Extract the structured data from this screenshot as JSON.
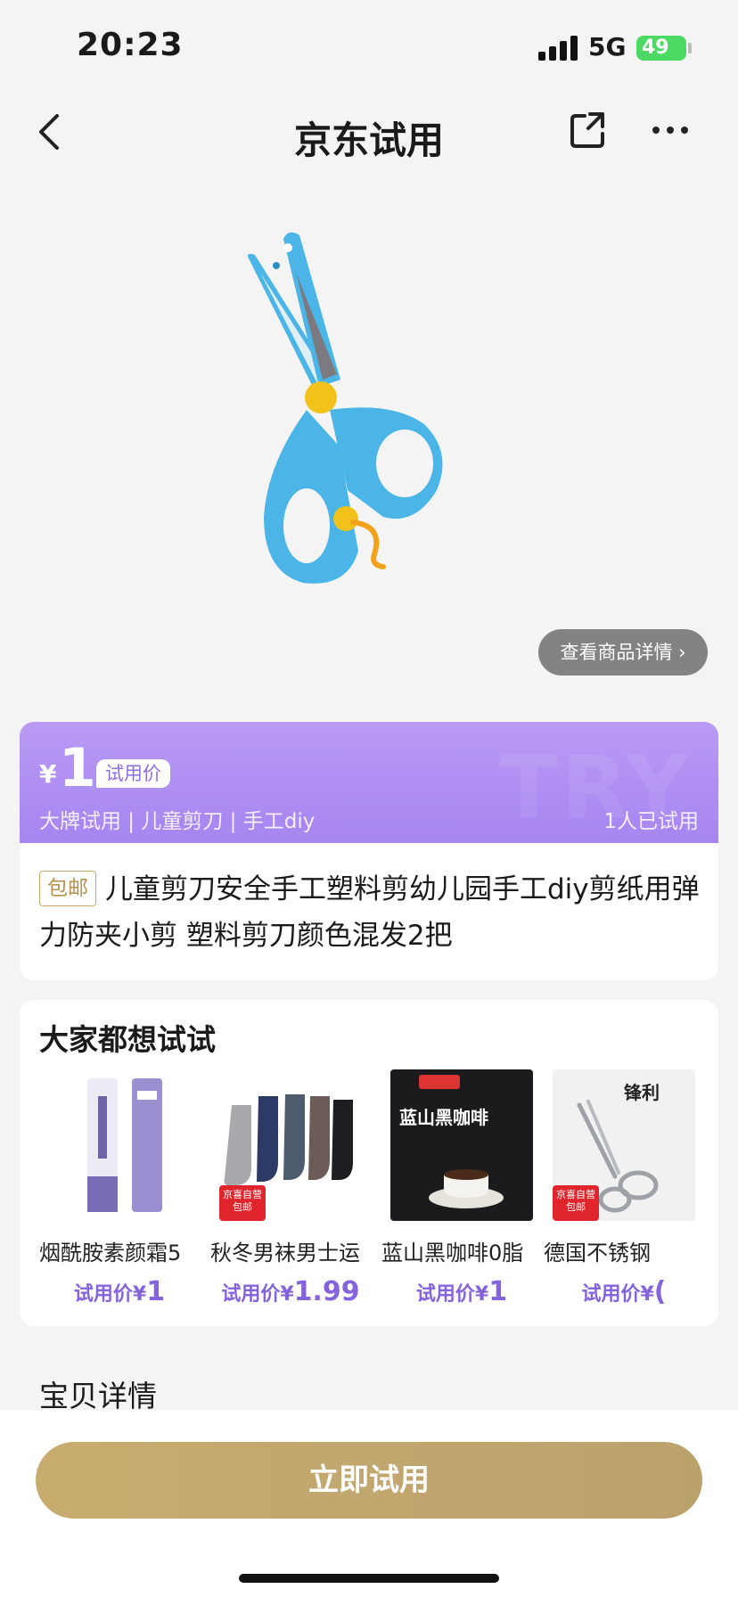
{
  "status": {
    "time": "20:23",
    "network": "5G",
    "battery": "49"
  },
  "nav": {
    "title": "京东试用"
  },
  "hero": {
    "detail_button": "查看商品详情"
  },
  "price": {
    "currency": "¥",
    "value": "1",
    "tag": "试用价",
    "tags": "大牌试用 | 儿童剪刀 | 手工diy",
    "tried": "1人已试用",
    "watermark": "TRY"
  },
  "product": {
    "badge": "包邮",
    "title": "儿童剪刀安全手工塑料剪幼儿园手工diy剪纸用弹力防夹小剪 塑料剪刀颜色混发2把"
  },
  "recommend": {
    "title": "大家都想试试",
    "items": [
      {
        "name": "烟酰胺素颜霜5",
        "price_label": "试用价¥",
        "price": "1"
      },
      {
        "name": "秋冬男袜男士运",
        "price_label": "试用价¥",
        "price": "1.99",
        "pin": "京喜自营 包邮"
      },
      {
        "name": "蓝山黑咖啡0脂",
        "price_label": "试用价¥",
        "price": "1",
        "box_text": "蓝山黑咖啡"
      },
      {
        "name": "德国不锈钢",
        "price_label": "试用价¥",
        "price": "(",
        "pin": "京喜自营 包邮",
        "img_text": "锋利"
      }
    ]
  },
  "details": {
    "title": "宝贝详情"
  },
  "cta": {
    "label": "立即试用"
  },
  "colors": {
    "accent_purple": "#a585f0",
    "gold": "#c8ac6f",
    "scissors_blue": "#4ab5e6"
  }
}
